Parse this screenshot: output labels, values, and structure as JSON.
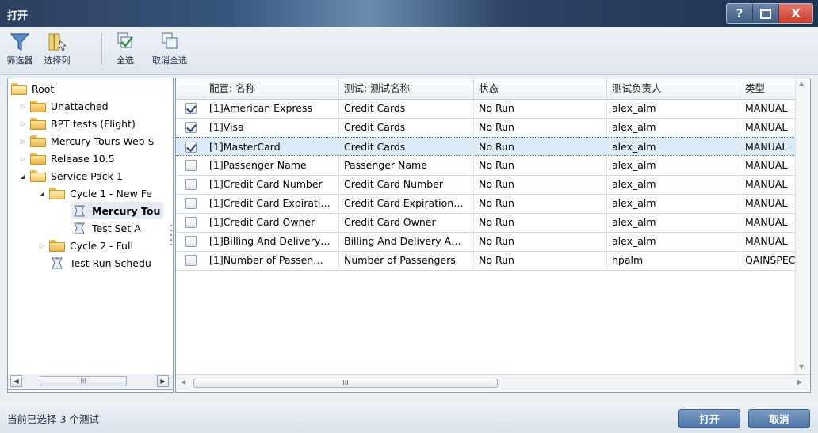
{
  "window": {
    "title": "打开",
    "help_label": "?",
    "close_label": "X"
  },
  "toolbar": {
    "filter_label": "筛选器",
    "columns_label": "选择列",
    "select_all_label": "全选",
    "deselect_all_label": "取消全选"
  },
  "tree": {
    "root": "Root",
    "items": [
      {
        "label": "Unattached",
        "level": 1,
        "icon": "folder-icon",
        "expander": "collapsed"
      },
      {
        "label": "BPT tests (Flight)",
        "level": 1,
        "icon": "folder-icon",
        "expander": "collapsed"
      },
      {
        "label": "Mercury Tours Web $",
        "level": 1,
        "icon": "folder-icon",
        "expander": "collapsed"
      },
      {
        "label": "Release 10.5",
        "level": 1,
        "icon": "folder-icon",
        "expander": "collapsed"
      },
      {
        "label": "Service Pack 1",
        "level": 1,
        "icon": "folder-open-icon",
        "expander": "expanded"
      },
      {
        "label": "Cycle 1 - New Fe",
        "level": 2,
        "icon": "folder-open-icon",
        "expander": "expanded"
      },
      {
        "label": "Mercury Tou",
        "level": 3,
        "icon": "test-set-icon",
        "selected": true
      },
      {
        "label": "Test Set A",
        "level": 3,
        "icon": "test-set-icon"
      },
      {
        "label": "Cycle 2 - Full",
        "level": 2,
        "icon": "folder-icon",
        "expander": "collapsed"
      },
      {
        "label": "Test Run Schedu",
        "level": 2,
        "icon": "test-set-icon"
      }
    ],
    "scroll_thumb": "III"
  },
  "grid": {
    "columns": [
      "配置: 名称",
      "测试: 测试名称",
      "状态",
      "测试负责人",
      "类型"
    ],
    "rows": [
      {
        "checked": true,
        "config": "[1]American Express",
        "test": "Credit Cards",
        "status": "No Run",
        "owner": "alex_alm",
        "type": "MANUAL"
      },
      {
        "checked": true,
        "config": "[1]Visa",
        "test": "Credit Cards",
        "status": "No Run",
        "owner": "alex_alm",
        "type": "MANUAL"
      },
      {
        "checked": true,
        "config": "[1]MasterCard",
        "test": "Credit Cards",
        "status": "No Run",
        "owner": "alex_alm",
        "type": "MANUAL",
        "focused": true
      },
      {
        "checked": false,
        "config": "[1]Passenger Name",
        "test": "Passenger Name",
        "status": "No Run",
        "owner": "alex_alm",
        "type": "MANUAL"
      },
      {
        "checked": false,
        "config": "[1]Credit Card Number",
        "test": "Credit Card Number",
        "status": "No Run",
        "owner": "alex_alm",
        "type": "MANUAL"
      },
      {
        "checked": false,
        "config": "[1]Credit Card Expirati…",
        "test": "Credit Card Expiration…",
        "status": "No Run",
        "owner": "alex_alm",
        "type": "MANUAL"
      },
      {
        "checked": false,
        "config": "[1]Credit Card Owner",
        "test": "Credit Card Owner",
        "status": "No Run",
        "owner": "alex_alm",
        "type": "MANUAL"
      },
      {
        "checked": false,
        "config": "[1]Billing And Delivery…",
        "test": "Billing And Delivery A…",
        "status": "No Run",
        "owner": "alex_alm",
        "type": "MANUAL"
      },
      {
        "checked": false,
        "config": "[1]Number of Passen…",
        "test": "Number of Passengers",
        "status": "No Run",
        "owner": "hpalm",
        "type": "QAINSPECT"
      }
    ],
    "scroll_thumb": "III"
  },
  "status": {
    "text": "当前已选择 3 个测试"
  },
  "buttons": {
    "open": "打开",
    "cancel": "取消"
  }
}
